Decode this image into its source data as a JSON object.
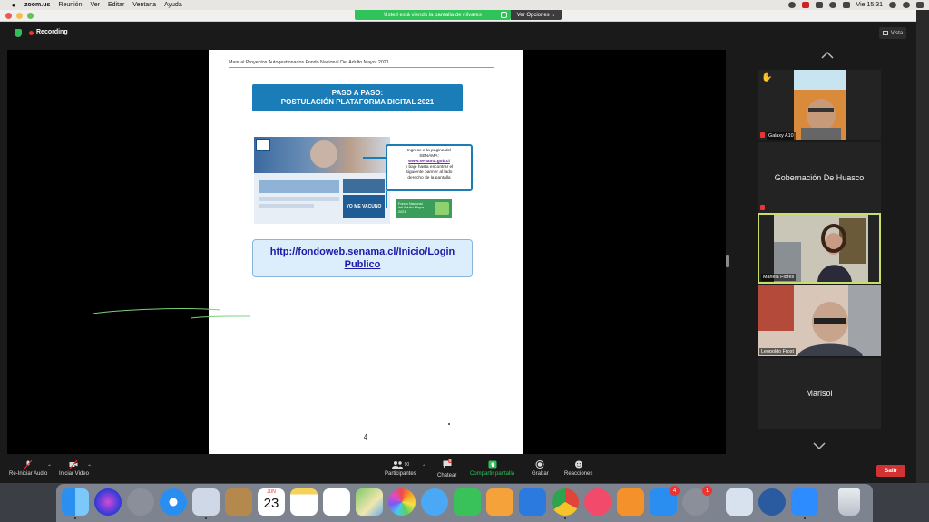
{
  "menubar": {
    "app": "zoom.us",
    "menus": [
      "Reunión",
      "Ver",
      "Editar",
      "Ventana",
      "Ayuda"
    ],
    "clock": "Vie 15:31"
  },
  "share_banner": {
    "text": "Usted está viendo la pantalla de nilvares",
    "view_options": "Ver Opciones ⌄"
  },
  "window": {
    "recording_label": "Recording",
    "view_button": "Vista"
  },
  "document": {
    "header": "Manual Proyectos Autogestionados Fondo Nacional Del Adulto Mayor 2021",
    "title_line1": "PASO A PASO:",
    "title_line2": "POSTULACIÓN PLATAFORMA DIGITAL 2021",
    "callout_line1": "Ingrese a la página del",
    "callout_line2": "SENAMA:",
    "callout_link": "www.senama.gob.cl",
    "callout_line3": "y baje hasta encontrar el",
    "callout_line4": "siguiente banner al lado",
    "callout_line5": "derecho de la pantalla",
    "banner_vacuno": "YO ME VACUNO",
    "fondo_line1": "Fondo Nacional",
    "fondo_line2": "del Adulto Mayor",
    "fondo_line3": "2021",
    "url_line1": "http://fondoweb.senama.cl/Inicio/Login",
    "url_line2": "Publico",
    "page_number": "4"
  },
  "gallery": {
    "participants": [
      {
        "name": "Galaxy A10",
        "video": true,
        "muted": true,
        "hand_raised": true
      },
      {
        "name": "Gobernación De Huasco",
        "video": false,
        "muted": true
      },
      {
        "name": "Mariela Flores",
        "video": true,
        "active_speaker": true
      },
      {
        "name": "Leopoldo Frost",
        "video": true
      },
      {
        "name": "Marisol",
        "video": false
      }
    ],
    "more_label": "···"
  },
  "toolbar": {
    "audio_label": "Re-Iniciar Audio",
    "video_label": "Iniciar Video",
    "participants_label": "Participantes",
    "participants_count": "90",
    "chat_label": "Chatear",
    "chat_badge": "8",
    "share_label": "Compartir pantalla",
    "record_label": "Grabar",
    "reactions_label": "Reacciones",
    "leave_label": "Salir"
  },
  "dock": {
    "calendar_month": "JUN",
    "calendar_day": "23",
    "appstore_badge": "4",
    "sysprefs_badge": "1",
    "icons": [
      "finder-icon",
      "siri-icon",
      "launchpad-icon",
      "safari-icon",
      "mail-icon",
      "contacts-icon",
      "calendar-icon",
      "notes-icon",
      "reminders-icon",
      "maps-icon",
      "photos-icon",
      "messages-icon",
      "facetime-icon",
      "pages-icon",
      "keynote-icon",
      "chrome-icon",
      "music-icon",
      "books-icon",
      "appstore-icon",
      "system-preferences-icon",
      "preview-icon",
      "quicktime-icon",
      "zoom-icon",
      "trash-icon"
    ]
  },
  "colors": {
    "share_green": "#2fc35a",
    "title_blue": "#1b7db8",
    "leave_red": "#d13232",
    "active_speaker": "#c7e06b"
  }
}
